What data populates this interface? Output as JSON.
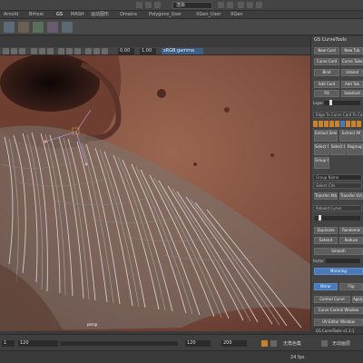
{
  "topbar": {
    "mode_value": "渲染"
  },
  "shelf_tabs": [
    "Arnold",
    "Bifrost",
    "GS",
    "MASH",
    "运动图形",
    "Omatra",
    "Polygons_User",
    "XGen_User",
    "XGen"
  ],
  "viewport": {
    "color_space": "sRGB gamma",
    "value_a": "0.00",
    "value_b": "1.00",
    "hud_label": "persp"
  },
  "gs_panel": {
    "title": "GS CurveTools",
    "buttons": {
      "new_card": "New Card",
      "new_tube": "New Tub",
      "curve_card": "Curve Card",
      "curve_tube": "Curve Tube",
      "bind": "Bind",
      "unbind": "Unbind",
      "add_card": "Add Card",
      "add_tube": "Add Tub",
      "fill": "Fill",
      "subdivide": "Subdivid",
      "edge_to_curve": "Edge To Curve Card To Cu",
      "extract_selected": "Extract Selected",
      "extract_all": "Extract All",
      "select_curves": "Select Curves",
      "select_cards": "Select Card",
      "group_curves": "Group Curves",
      "regroup": "Regroup",
      "duplicate": "Duplicate",
      "randomize": "Randomiz",
      "extend": "Extend",
      "reduce": "Reduce",
      "smooth": "Smooth",
      "mirror": "Mirror",
      "flip": "Flip",
      "control_curve": "Control Curve",
      "apply": "Apply",
      "curve_control_window": "Curve Control Window",
      "uv_editor_window": "UV Editor Window"
    },
    "labels": {
      "layer": "Layer",
      "group_name": "Group Name",
      "select_cvs": "Select CVs",
      "transfer_attr": "Transfer Attr",
      "transfer_uvs": "Transfer UVs",
      "rebuild_curve": "Rebuild Curve",
      "factor": "factor",
      "mirroring": "Mirroring",
      "footer": "GS CurveTools v1.3.1"
    },
    "layer_count": "10"
  },
  "statusbar": {
    "frame_start": "1",
    "frame_current": "120",
    "range_end": "120",
    "range_max": "200",
    "character_set": "无角色集",
    "anim_layer": "无动画层",
    "fps": "24 fps"
  },
  "colors": {
    "accent_blue": "#4a7ab8",
    "accent_orange": "#c9822e",
    "panel_bg": "#444444"
  }
}
